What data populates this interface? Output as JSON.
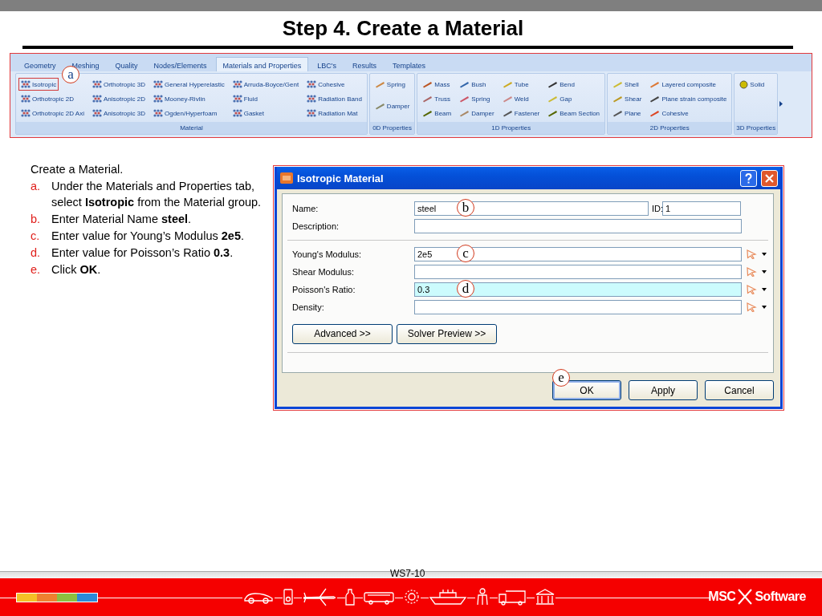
{
  "title": "Step 4. Create a Material",
  "ribbon": {
    "tabs": [
      {
        "label": "Geometry",
        "selected": false
      },
      {
        "label": "Meshing",
        "selected": false
      },
      {
        "label": "Quality",
        "selected": false
      },
      {
        "label": "Nodes/Elements",
        "selected": false
      },
      {
        "label": "Materials and Properties",
        "selected": true
      },
      {
        "label": "LBC's",
        "selected": false
      },
      {
        "label": "Results",
        "selected": false
      },
      {
        "label": "Templates",
        "selected": false
      }
    ],
    "groups": [
      {
        "label": "Material",
        "kind": "material",
        "items": [
          {
            "label": "Isotropic",
            "highlighted": true,
            "callout": "a"
          },
          {
            "label": "Orthotropic 2D",
            "highlighted": false
          },
          {
            "label": "Orthotropic 2D Axi",
            "highlighted": false
          },
          {
            "label": "Orthotropic 3D",
            "highlighted": false
          },
          {
            "label": "Anisotropic 2D",
            "highlighted": false
          },
          {
            "label": "Anisotropic 3D",
            "highlighted": false
          },
          {
            "label": "General Hyperelastic",
            "highlighted": false
          },
          {
            "label": "Mooney-Rivlin",
            "highlighted": false
          },
          {
            "label": "Ogden/Hyperfoam",
            "highlighted": false
          },
          {
            "label": "Arruda-Boyce/Gent",
            "highlighted": false
          },
          {
            "label": "Fluid",
            "highlighted": false
          },
          {
            "label": "Gasket",
            "highlighted": false
          },
          {
            "label": "Cohesive",
            "highlighted": false
          },
          {
            "label": "Radiation Band",
            "highlighted": false
          },
          {
            "label": "Radiation Mat",
            "highlighted": false
          }
        ]
      },
      {
        "label": "0D Properties",
        "kind": "property",
        "items": [
          {
            "label": "Spring",
            "highlighted": false
          },
          {
            "label": "Damper",
            "highlighted": false
          }
        ]
      },
      {
        "label": "1D Properties",
        "kind": "property",
        "items": [
          {
            "label": "Mass",
            "highlighted": false
          },
          {
            "label": "Truss",
            "highlighted": false
          },
          {
            "label": "Beam",
            "highlighted": false
          },
          {
            "label": "Bush",
            "highlighted": false
          },
          {
            "label": "Spring",
            "highlighted": false
          },
          {
            "label": "Damper",
            "highlighted": false
          },
          {
            "label": "Tube",
            "highlighted": false
          },
          {
            "label": "Weld",
            "highlighted": false
          },
          {
            "label": "Fastener",
            "highlighted": false
          },
          {
            "label": "Bend",
            "highlighted": false
          },
          {
            "label": "Gap",
            "highlighted": false
          },
          {
            "label": "Beam Section",
            "highlighted": false
          }
        ]
      },
      {
        "label": "2D Properties",
        "kind": "property",
        "items": [
          {
            "label": "Shell",
            "highlighted": false
          },
          {
            "label": "Shear",
            "highlighted": false
          },
          {
            "label": "Plane",
            "highlighted": false
          },
          {
            "label": "Layered composite",
            "highlighted": false
          },
          {
            "label": "Plane strain composite",
            "highlighted": false
          },
          {
            "label": "Cohesive",
            "highlighted": false
          }
        ]
      },
      {
        "label": "3D Properties",
        "kind": "property",
        "items": [
          {
            "label": "Solid",
            "highlighted": false
          }
        ]
      }
    ]
  },
  "instructions": {
    "intro": "Create a Material.",
    "steps": [
      {
        "marker": "a.",
        "text": "Under the Materials and Properties tab, select **Isotropic** from the Material group."
      },
      {
        "marker": "b.",
        "text": "Enter Material Name **steel**."
      },
      {
        "marker": "c.",
        "text": "Enter value for Young’s Modulus **2e5**."
      },
      {
        "marker": "d.",
        "text": "Enter value for Poisson’s Ratio **0.3**."
      },
      {
        "marker": "e.",
        "text": "Click **OK**."
      }
    ]
  },
  "dialog": {
    "title": "Isotropic Material",
    "header_fields": [
      {
        "label": "Name:",
        "value": "steel",
        "callout": "b"
      },
      {
        "label": "Description:"
      }
    ],
    "id_field": {
      "label": "ID:",
      "value": "1"
    },
    "property_fields": [
      {
        "label": "Young's Modulus:",
        "value": "2e5",
        "callout": "c",
        "focused": false
      },
      {
        "label": "Shear Modulus:",
        "focused": false
      },
      {
        "label": "Poisson's Ratio:",
        "value": "0.3",
        "callout": "d",
        "focused": true
      },
      {
        "label": "Density:",
        "focused": false
      }
    ],
    "buttons": [
      "Advanced >>",
      "Solver Preview >>"
    ],
    "footer_buttons": [
      {
        "label": "OK",
        "default": true,
        "callout": "e"
      },
      {
        "label": "Apply",
        "default": false
      },
      {
        "label": "Cancel",
        "default": false
      }
    ]
  },
  "footer": {
    "page_number": "WS7-10",
    "logo_left": "MSC",
    "logo_right": "Software"
  }
}
